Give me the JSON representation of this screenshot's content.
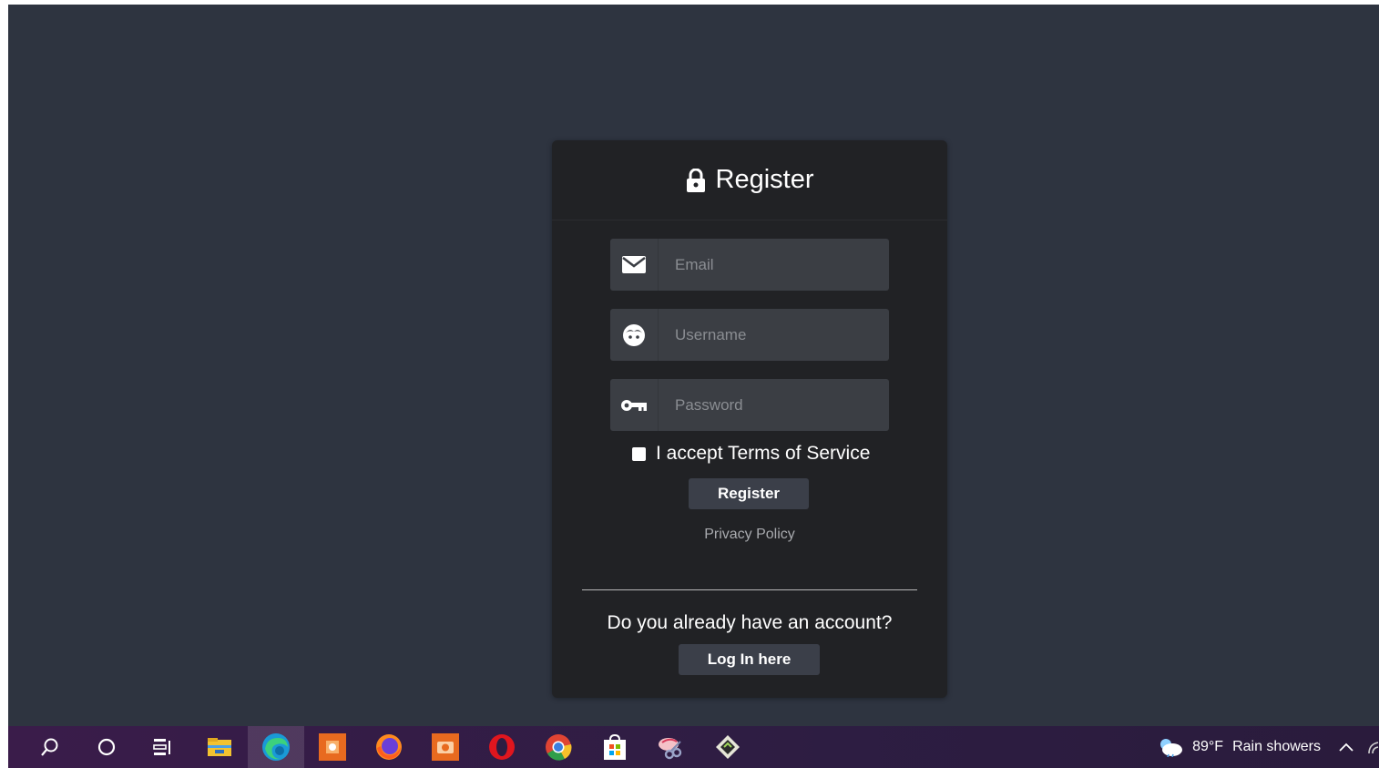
{
  "form": {
    "title": "Register",
    "email_placeholder": "Email",
    "username_placeholder": "Username",
    "password_placeholder": "Password",
    "terms_label": "I accept Terms of Service",
    "register_button": "Register",
    "privacy_link": "Privacy Policy",
    "login_prompt": "Do you already have an account?",
    "login_button": "Log In here"
  },
  "colors": {
    "page_bg": "#2e3440",
    "card_bg": "#212225",
    "input_bg": "#3b3e44",
    "button_bg": "#3b3f49"
  },
  "taskbar": {
    "apps": [
      "search-icon",
      "cortana-icon",
      "task-view-icon",
      "file-explorer-icon",
      "edge-icon",
      "app-orange-icon",
      "firefox-icon",
      "camera-app-icon",
      "opera-icon",
      "chrome-icon",
      "store-icon",
      "snipping-tool-icon",
      "app-diamond-icon"
    ],
    "weather_temp": "89°F",
    "weather_text": "Rain showers"
  }
}
